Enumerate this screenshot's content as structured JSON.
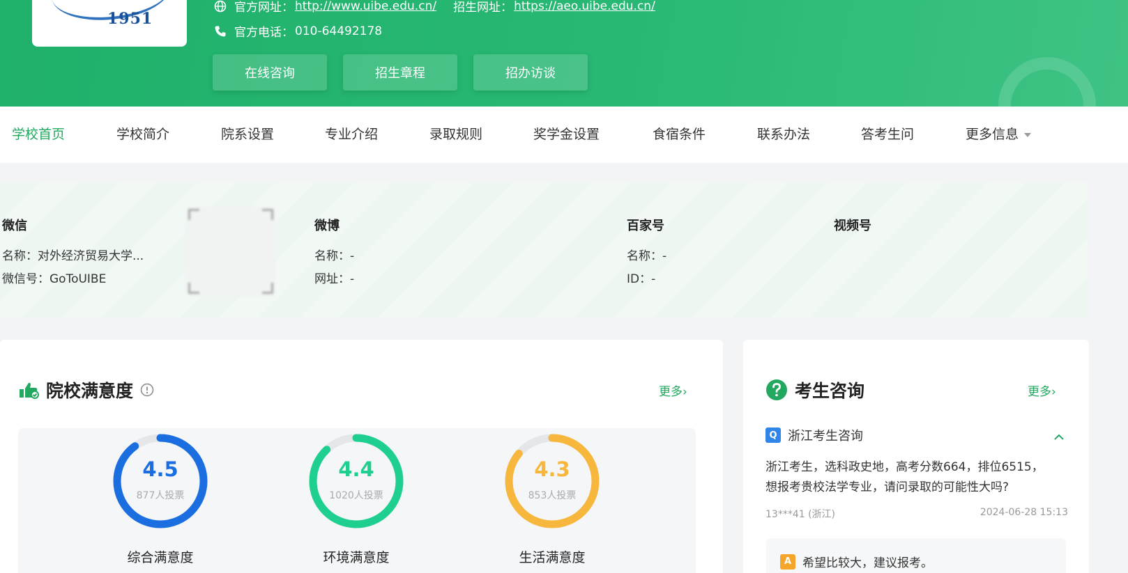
{
  "header": {
    "logo_year": "1951",
    "official_site_label": "官方网址：",
    "official_site_url": "http://www.uibe.edu.cn/",
    "admission_site_label": "招生网址：",
    "admission_site_url": "https://aeo.uibe.edu.cn/",
    "phone_label": "官方电话：",
    "phone": "010-64492178",
    "buttons": [
      "在线咨询",
      "招生章程",
      "招办访谈"
    ]
  },
  "nav": {
    "items": [
      "学校首页",
      "学校简介",
      "院系设置",
      "专业介绍",
      "录取规则",
      "奖学金设置",
      "食宿条件",
      "联系办法",
      "答考生问",
      "更多信息"
    ],
    "active": "学校首页"
  },
  "social": {
    "wechat": {
      "title": "微信",
      "name": "名称：对外经济贸易大学...",
      "id": "微信号：GoToUIBE"
    },
    "weibo": {
      "title": "微博",
      "name": "名称：-",
      "url": "网址：-"
    },
    "baijiahao": {
      "title": "百家号",
      "name": "名称：-",
      "id": "ID：-"
    },
    "video": {
      "title": "视频号"
    }
  },
  "satisfaction": {
    "title": "院校满意度",
    "more": "更多›",
    "ratings": [
      {
        "score": "4.5",
        "votes": "877人投票",
        "name": "综合满意度",
        "fraction": 0.9,
        "color": "#1a6ee0"
      },
      {
        "score": "4.4",
        "votes": "1020人投票",
        "name": "环境满意度",
        "fraction": 0.88,
        "color": "#1fcf8f"
      },
      {
        "score": "4.3",
        "votes": "853人投票",
        "name": "生活满意度",
        "fraction": 0.86,
        "color": "#f6b73c"
      }
    ]
  },
  "consult": {
    "title": "考生咨询",
    "more": "更多›",
    "question_title": "浙江考生咨询",
    "question_line1": "浙江考生，选科政史地，高考分数664，排位6515，",
    "question_line2": "想报考贵校法学专业，请问录取的可能性大吗?",
    "user": "13***41 (浙江)",
    "time": "2024-06-28 15:13",
    "answer": "希望比较大，建议报考。",
    "q_tag": "Q",
    "a_tag": "A"
  },
  "colors": {
    "brand_green": "#22a85f",
    "header_green": "#28b874"
  }
}
